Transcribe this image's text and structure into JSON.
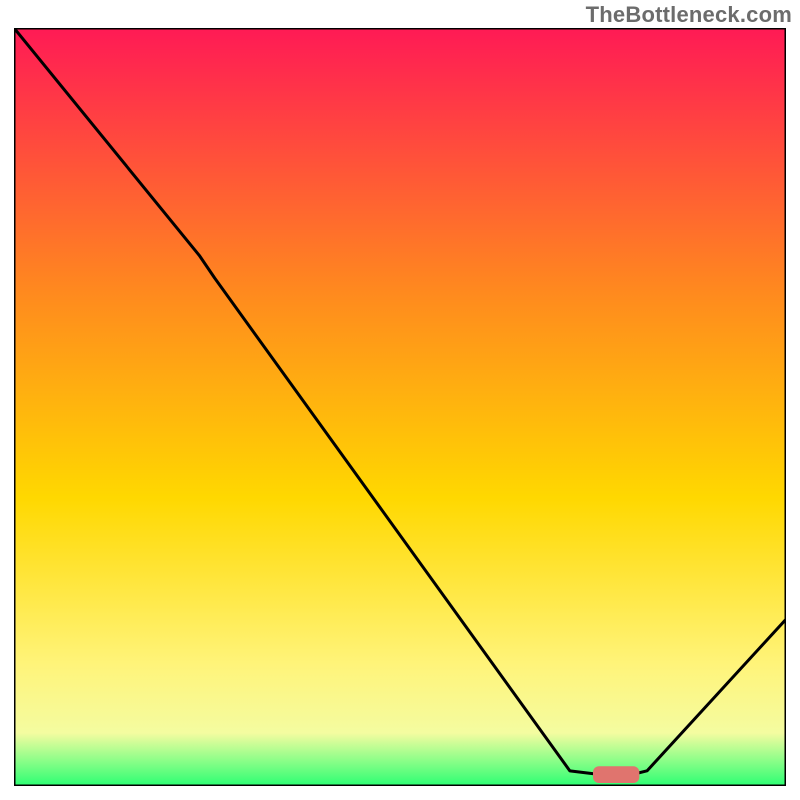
{
  "watermark": "TheBottleneck.com",
  "chart_data": {
    "type": "line",
    "title": "",
    "xlabel": "",
    "ylabel": "",
    "xlim": [
      0,
      100
    ],
    "ylim": [
      0,
      100
    ],
    "grid": false,
    "legend": false,
    "background_gradient": {
      "top_color": "#ff1a55",
      "mid1_color": "#ff8a1e",
      "mid2_color": "#ffd800",
      "low1_color": "#fff47a",
      "low2_color": "#f4fca0",
      "bottom_color": "#2cff73"
    },
    "series": [
      {
        "name": "bottleneck-curve",
        "color": "#000000",
        "points": [
          {
            "x": 0,
            "y": 100
          },
          {
            "x": 24,
            "y": 70
          },
          {
            "x": 26,
            "y": 67
          },
          {
            "x": 72,
            "y": 2
          },
          {
            "x": 76,
            "y": 1.5
          },
          {
            "x": 80,
            "y": 1.5
          },
          {
            "x": 82,
            "y": 2
          },
          {
            "x": 100,
            "y": 22
          }
        ]
      }
    ],
    "marker": {
      "name": "optimal-zone",
      "color": "#e0746e",
      "x_start": 75,
      "x_end": 81,
      "y": 1.5,
      "thickness": 2.2
    }
  }
}
